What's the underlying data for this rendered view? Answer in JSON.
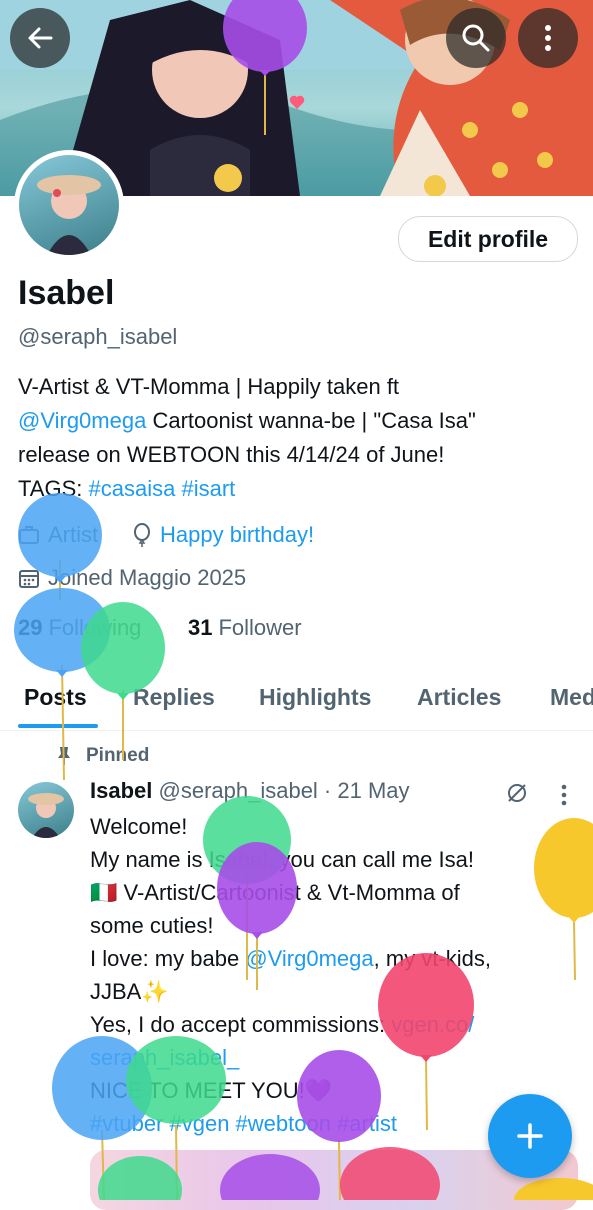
{
  "header": {
    "back_icon": "arrow-left-icon",
    "search_icon": "search-icon",
    "more_icon": "more-vertical-icon"
  },
  "profile": {
    "edit_label": "Edit profile",
    "name": "Isabel",
    "handle": "@seraph_isabel",
    "bio": {
      "line1": "V-Artist & VT-Momma | Happily taken ft",
      "mention": "@Virg0mega",
      "line2_rest": " Cartoonist wanna-be |  \"Casa Isa\"",
      "line3": "release on WEBTOON this 4/14/24 of June!",
      "tags_label": "TAGS: ",
      "tag1": "#casaisa",
      "tag2": "#isart"
    },
    "category": "Artist",
    "birthday": "Happy birthday!",
    "joined": "Joined Maggio 2025",
    "following_count": "29",
    "following_label": "Following",
    "follower_count": "31",
    "follower_label": "Follower"
  },
  "tabs": [
    "Posts",
    "Replies",
    "Highlights",
    "Articles",
    "Media"
  ],
  "pinned_post": {
    "pinned_label": "Pinned",
    "author": "Isabel",
    "handle_date": "@seraph_isabel · 21 May",
    "lines": {
      "l1": "Welcome!",
      "l2": "My name is Isabel, you can call me Isa!",
      "l3": "🇮🇹 V-Artist/Cartoonist & Vt-Momma of",
      "l4": "some cuties!",
      "l5a": "I love: my babe ",
      "l5m": "@Virg0mega",
      "l5b": ", my vt-kids,",
      "l6": "JJBA✨",
      "l7a": "Yes, I do accept commissions: ",
      "l7link": "vgen.co/",
      "l8link": "seraph_isabel_",
      "l9": "NICE TO MEET YOU!💜",
      "hashtags": "#vtuber #vgen #webtoon #artist"
    }
  },
  "fab_icon": "plus-icon",
  "colors": {
    "accent": "#1d9bf0",
    "text": "#0f1419",
    "muted": "#536471"
  }
}
